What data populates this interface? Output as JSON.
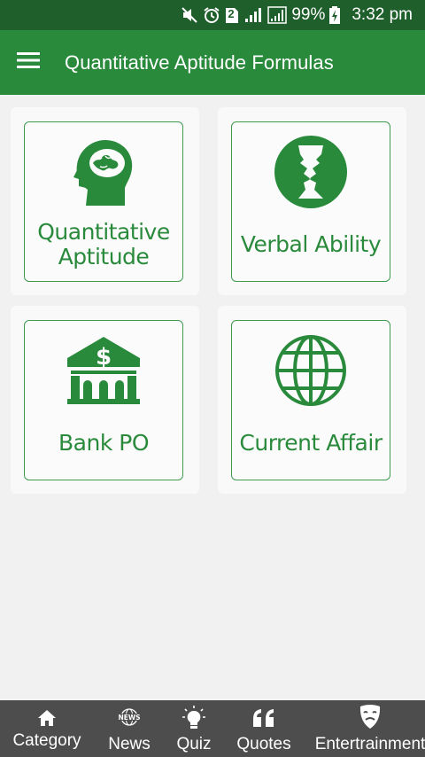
{
  "status_bar": {
    "battery": "99%",
    "time": "3:32 pm",
    "sim_badge": "2",
    "icons": [
      "mute-icon",
      "alarm-icon",
      "sim-2-icon",
      "signal-icon",
      "signal-icon",
      "battery-charging-icon"
    ]
  },
  "app_bar": {
    "title": "Quantitative Aptitude Formulas",
    "menu_icon": "hamburger-menu-icon"
  },
  "tiles": [
    {
      "label_line1": "Quantitative",
      "label_line2": "Aptitude",
      "icon": "head-brain-icon"
    },
    {
      "label": "Verbal Ability",
      "icon": "face-profile-vase-icon"
    },
    {
      "label": "Bank PO",
      "icon": "bank-dollar-icon"
    },
    {
      "label": "Current Affair",
      "icon": "globe-icon"
    }
  ],
  "bottom_nav": {
    "items": [
      {
        "label": "Category",
        "icon": "home-icon"
      },
      {
        "label": "News",
        "icon": "news-icon",
        "icon_text": "NEWS"
      },
      {
        "label": "Quiz",
        "icon": "lightbulb-icon"
      },
      {
        "label": "Quotes",
        "icon": "quote-icon"
      },
      {
        "label": "Entertrainment",
        "icon": "theater-mask-icon"
      }
    ]
  },
  "colors": {
    "status_bar": "#1f5f2c",
    "app_bar": "#2a8a3c",
    "accent_green": "#2a8a3c",
    "bottom_nav": "#4d4d4d",
    "background": "#f1f1f1"
  }
}
